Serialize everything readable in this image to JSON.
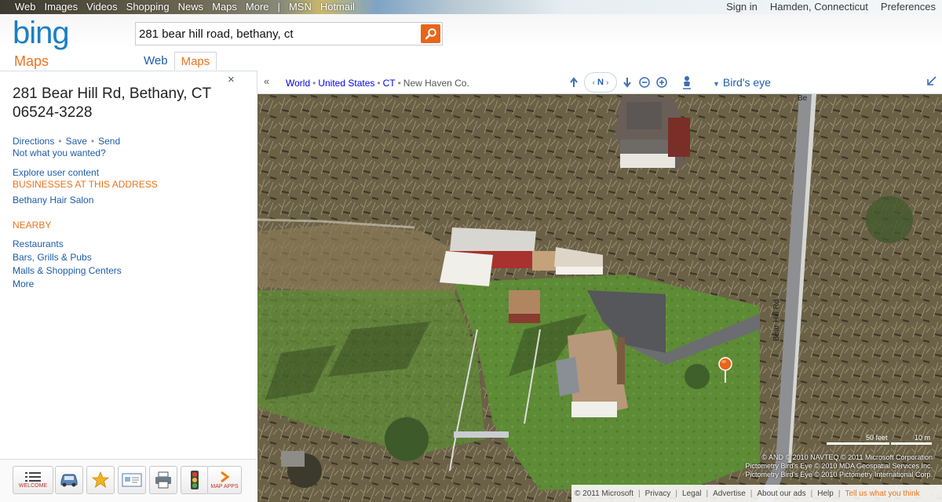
{
  "top_nav": {
    "links": [
      "Web",
      "Images",
      "Videos",
      "Shopping",
      "News",
      "Maps",
      "More"
    ],
    "divider": "|",
    "extra_links": [
      "MSN",
      "Hotmail"
    ],
    "right": {
      "sign_in": "Sign in",
      "location": "Hamden, Connecticut",
      "preferences": "Preferences"
    }
  },
  "header": {
    "logo_text": "bing",
    "section_label": "Maps",
    "search": {
      "value": "281 bear hill road, bethany, ct",
      "button_icon": "search-icon"
    },
    "scope_tabs": [
      {
        "label": "Web",
        "active": false
      },
      {
        "label": "Maps",
        "active": true
      }
    ]
  },
  "left_panel": {
    "close_label": "×",
    "address_line1": "281 Bear Hill Rd, Bethany, CT",
    "address_line2": "06524-3228",
    "actions": [
      "Directions",
      "Save",
      "Send"
    ],
    "action_separator": "•",
    "not_what_you_wanted": "Not what you wanted?",
    "explore": "Explore user content",
    "businesses_heading": "BUSINESSES AT THIS ADDRESS",
    "business": "Bethany Hair Salon",
    "nearby_heading": "NEARBY",
    "nearby": [
      "Restaurants",
      "Bars, Grills & Pubs",
      "Malls & Shopping Centers",
      "More"
    ]
  },
  "toolbar": {
    "items": [
      {
        "icon": "list-icon",
        "label": "WELCOME"
      },
      {
        "icon": "car-icon",
        "label": ""
      },
      {
        "icon": "star-icon",
        "label": ""
      },
      {
        "icon": "card-icon",
        "label": ""
      },
      {
        "icon": "printer-icon",
        "label": ""
      },
      {
        "icon": "traffic-light-icon",
        "label": ""
      },
      {
        "icon": "chevron-right-icon",
        "label": "MAP APPS"
      }
    ]
  },
  "map_bar": {
    "collapse_label": "«",
    "breadcrumb": [
      "World",
      "United States",
      "CT",
      "New Haven Co."
    ],
    "breadcrumb_separator": "•",
    "compass_label": "N",
    "view_mode": "Bird's eye"
  },
  "map": {
    "road_label": "Bear Hill Rd",
    "road_label_top": "Be",
    "scale_feet": "50 feet",
    "scale_meters": "10 m",
    "copyright_lines": [
      "© AND  © 2010 NAVTEQ  © 2011 Microsoft Corporation",
      "Pictometry Bird's Eye © 2010 MDA Geospatial Services Inc.",
      "Pictometry Bird's Eye © 2010 Pictometry International Corp."
    ],
    "pin_color": "#e8651a"
  },
  "footer": {
    "links": [
      "© 2011 Microsoft",
      "Privacy",
      "Legal",
      "Advertise",
      "About our ads",
      "Help"
    ],
    "separator": "|",
    "tell_us": "Tell us what you think"
  },
  "colors": {
    "accent_orange": "#e9741d",
    "link_blue": "#1e5ca8",
    "bing_blue": "#1a7fc4"
  }
}
